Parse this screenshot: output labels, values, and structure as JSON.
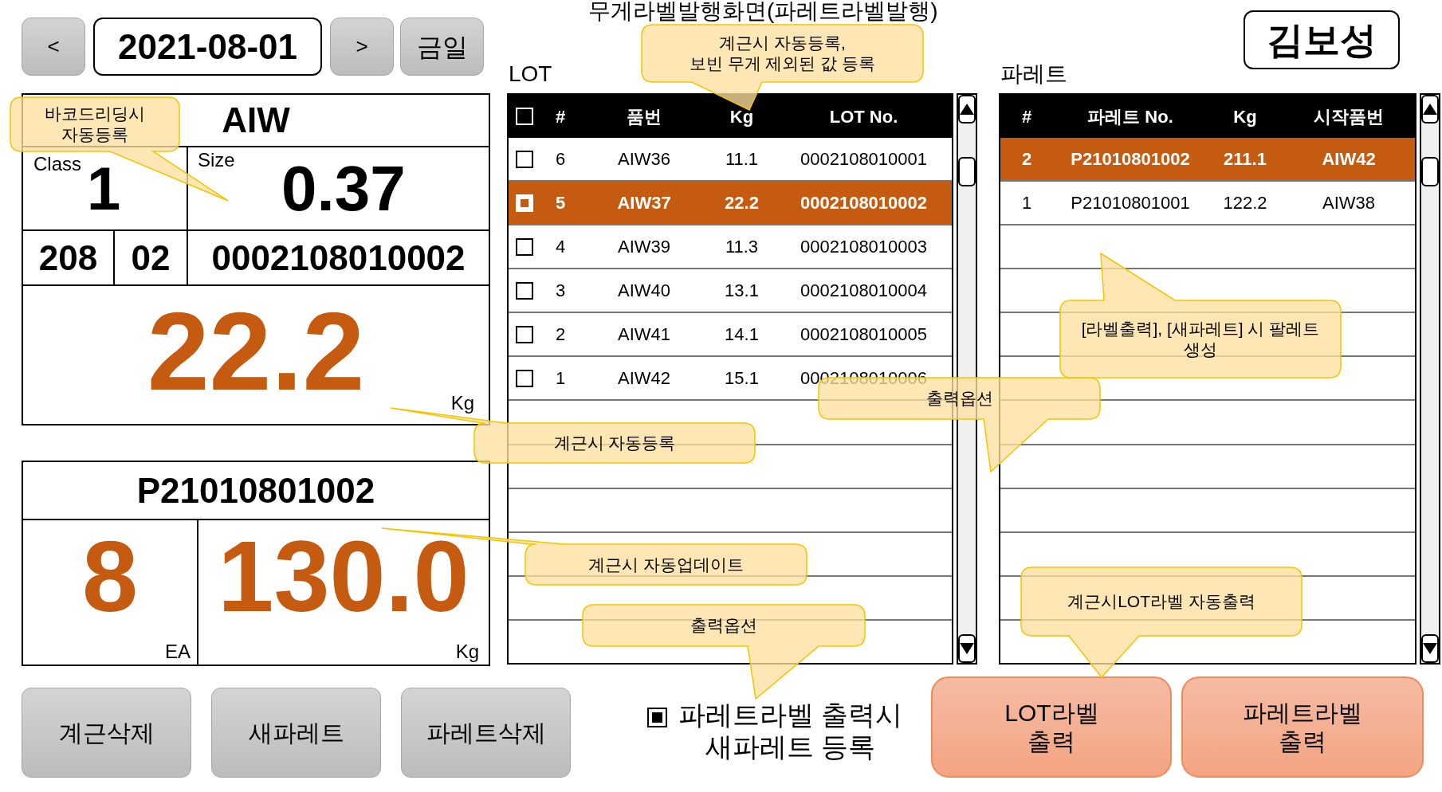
{
  "title": "무게라벨발행화면(파레트라벨발행)",
  "date_nav": {
    "prev": "<",
    "date": "2021-08-01",
    "next": ">",
    "today": "금일"
  },
  "operator": "김보성",
  "lot_info": {
    "item": "AIW",
    "class_label": "Class",
    "class": "1",
    "size_label": "Size",
    "size": "0.37",
    "code_1": "208",
    "code_2": "02",
    "lot_no": "0002108010002",
    "weight": "22.2",
    "weight_unit": "Kg"
  },
  "pallet_info": {
    "pallet_no": "P21010801002",
    "count": "8",
    "count_unit": "EA",
    "weight": "130.0",
    "weight_unit": "Kg"
  },
  "actions": [
    "계근삭제",
    "새파레트",
    "파레트삭제"
  ],
  "lot_table": {
    "label": "LOT",
    "header_checked": false,
    "columns": [
      "#",
      "품번",
      "Kg",
      "LOT No."
    ],
    "rows": [
      {
        "cells": [
          "6",
          "AIW36",
          "11.1",
          "0002108010001"
        ],
        "checked": false,
        "selected": false
      },
      {
        "cells": [
          "5",
          "AIW37",
          "22.2",
          "0002108010002"
        ],
        "checked": true,
        "selected": true
      },
      {
        "cells": [
          "4",
          "AIW39",
          "11.3",
          "0002108010003"
        ],
        "checked": false,
        "selected": false
      },
      {
        "cells": [
          "3",
          "AIW40",
          "13.1",
          "0002108010004"
        ],
        "checked": false,
        "selected": false
      },
      {
        "cells": [
          "2",
          "AIW41",
          "14.1",
          "0002108010005"
        ],
        "checked": false,
        "selected": false
      },
      {
        "cells": [
          "1",
          "AIW42",
          "15.1",
          "0002108010006"
        ],
        "checked": false,
        "selected": false
      }
    ]
  },
  "pallet_table": {
    "label": "파레트",
    "columns": [
      "#",
      "파레트 No.",
      "Kg",
      "시작품번"
    ],
    "rows": [
      {
        "cells": [
          "2",
          "P21010801002",
          "211.1",
          "AIW42"
        ],
        "selected": true
      },
      {
        "cells": [
          "1",
          "P21010801001",
          "122.2",
          "AIW38"
        ],
        "selected": false
      }
    ]
  },
  "option": {
    "checked": true,
    "label": "파레트라벨 출력시\n새파레트 등록"
  },
  "print_buttons": [
    "LOT라벨\n출력",
    "파레트라벨\n출력"
  ],
  "callouts": [
    "바코드리딩시\n자동등록",
    "계근시 자동등록,\n보빈 무게 제외된 값 등록",
    "계근시 자동등록",
    "출력옵션",
    "[라벨출력], [새파레트] 시 팔레트 생성",
    "계근시 자동업데이트",
    "출력옵션",
    "계근시LOT라벨 자동출력"
  ]
}
